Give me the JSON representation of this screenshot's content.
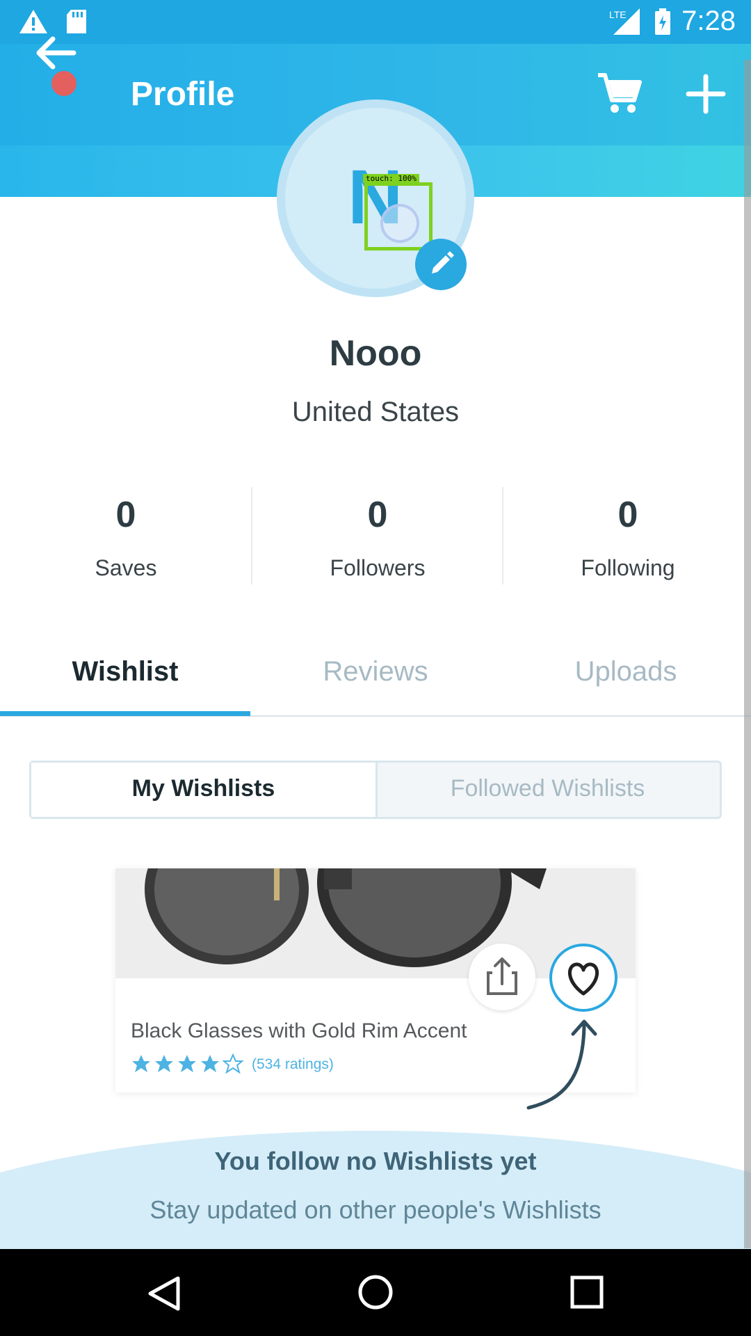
{
  "status_bar": {
    "time": "7:28",
    "network": "LTE"
  },
  "header": {
    "title": "Profile"
  },
  "profile": {
    "avatar_letter": "N",
    "name": "Nooo",
    "country": "United States",
    "touch_label": "touch: 100%"
  },
  "stats": [
    {
      "value": "0",
      "label": "Saves"
    },
    {
      "value": "0",
      "label": "Followers"
    },
    {
      "value": "0",
      "label": "Following"
    }
  ],
  "tabs": [
    {
      "label": "Wishlist",
      "active": true
    },
    {
      "label": "Reviews",
      "active": false
    },
    {
      "label": "Uploads",
      "active": false
    }
  ],
  "segments": [
    {
      "label": "My Wishlists",
      "active": true
    },
    {
      "label": "Followed Wishlists",
      "active": false
    }
  ],
  "card": {
    "title": "Black Glasses with Gold Rim Accent",
    "rating": 4,
    "rating_text": "(534 ratings)"
  },
  "empty_state": {
    "title": "You follow no Wishlists yet",
    "subtitle": "Stay updated on other people's Wishlists"
  },
  "colors": {
    "accent": "#2aa8e0",
    "header": "#29b6ea",
    "text_dark": "#2d3c42"
  },
  "icons": [
    "warning-icon",
    "sd-card-icon",
    "signal-icon",
    "battery-icon",
    "back-arrow-icon",
    "cart-icon",
    "plus-icon",
    "pencil-icon",
    "share-icon",
    "heart-icon",
    "star-icon",
    "nav-back-icon",
    "nav-home-icon",
    "nav-recents-icon"
  ]
}
